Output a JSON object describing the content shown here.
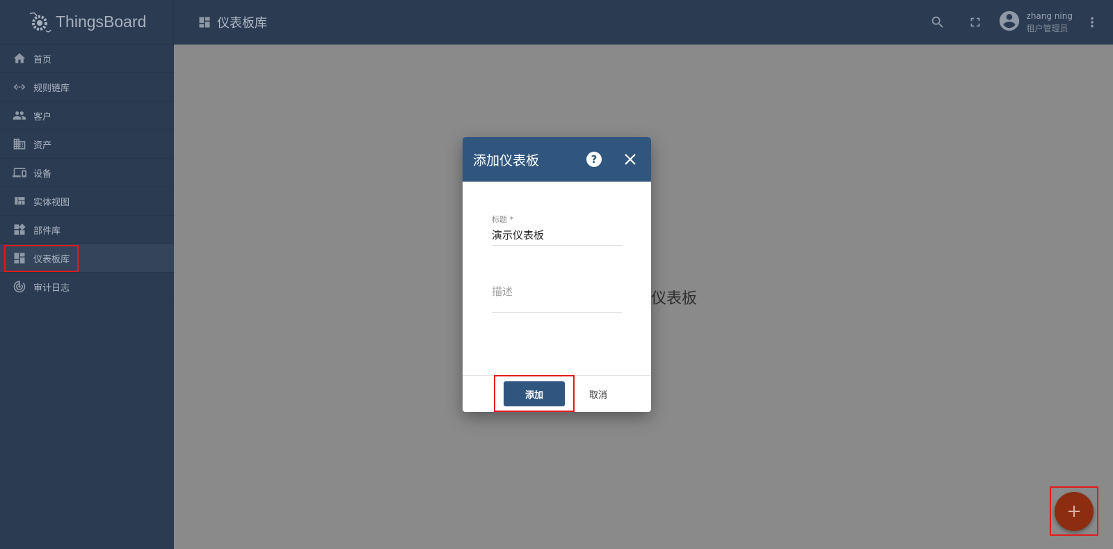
{
  "app": {
    "name": "ThingsBoard"
  },
  "sidebar": {
    "items": [
      {
        "label": "首页",
        "icon": "home-icon"
      },
      {
        "label": "规则链库",
        "icon": "code-arrows-icon"
      },
      {
        "label": "客户",
        "icon": "people-icon"
      },
      {
        "label": "资产",
        "icon": "building-icon"
      },
      {
        "label": "设备",
        "icon": "devices-icon"
      },
      {
        "label": "实体视图",
        "icon": "view-quilt-icon"
      },
      {
        "label": "部件库",
        "icon": "widgets-icon"
      },
      {
        "label": "仪表板库",
        "icon": "dashboard-icon",
        "active": true
      },
      {
        "label": "审计日志",
        "icon": "track-changes-icon"
      }
    ]
  },
  "topbar": {
    "title": "仪表板库",
    "user_name": "zhang ning",
    "user_role": "租户管理员"
  },
  "main": {
    "empty_text": "仪表板"
  },
  "dialog": {
    "title": "添加仪表板",
    "title_field_label": "标题 *",
    "title_field_value": "演示仪表板",
    "description_placeholder": "描述",
    "add_label": "添加",
    "cancel_label": "取消"
  },
  "fab": {
    "symbol": "+"
  },
  "colors": {
    "sidebar_bg": "#2b3c52",
    "dialog_header": "#305680",
    "fab": "#8c2c10",
    "highlight": "#e21b1b"
  }
}
